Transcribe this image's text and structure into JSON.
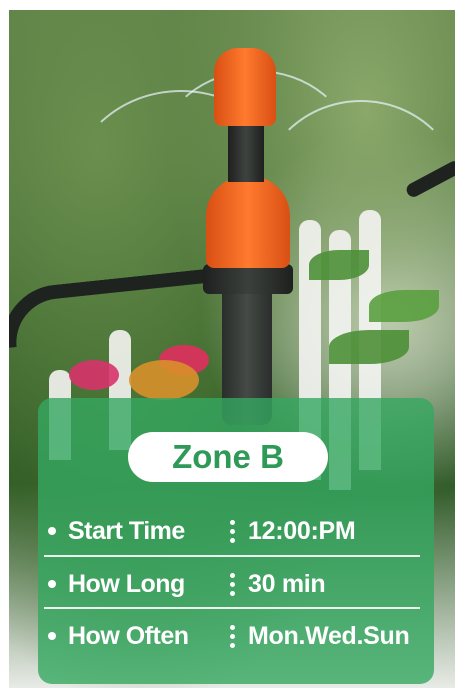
{
  "zone": {
    "title": "Zone B"
  },
  "schedule": {
    "rows": [
      {
        "label": "Start Time",
        "value": "12:00:PM"
      },
      {
        "label": "How Long",
        "value": "30 min"
      },
      {
        "label": "How Often",
        "value": "Mon.Wed.Sun"
      }
    ]
  },
  "colors": {
    "accent": "#2f9a58",
    "panel": "#34a860",
    "sprinkler": "#ff7a2e"
  }
}
